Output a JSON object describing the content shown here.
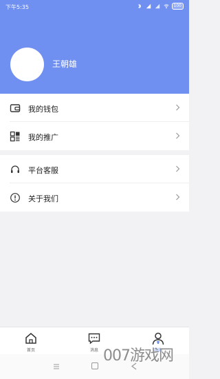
{
  "status_bar": {
    "time": "下午5:35",
    "battery": "100"
  },
  "profile": {
    "name": "王朝雄"
  },
  "menu": {
    "group1": [
      {
        "label": "我的钱包",
        "icon": "wallet-icon"
      },
      {
        "label": "我的推广",
        "icon": "promotion-icon"
      }
    ],
    "group2": [
      {
        "label": "平台客服",
        "icon": "headset-icon"
      },
      {
        "label": "关于我们",
        "icon": "info-icon"
      }
    ]
  },
  "tabbar": {
    "tabs": [
      {
        "label": "首页",
        "icon": "home-icon",
        "active": false
      },
      {
        "label": "消息",
        "icon": "message-icon",
        "active": false
      },
      {
        "label": "我的",
        "icon": "profile-icon",
        "active": true
      }
    ]
  },
  "watermark": "007游戏网",
  "colors": {
    "accent": "#6f8ff1",
    "background": "#f2f2f4"
  }
}
